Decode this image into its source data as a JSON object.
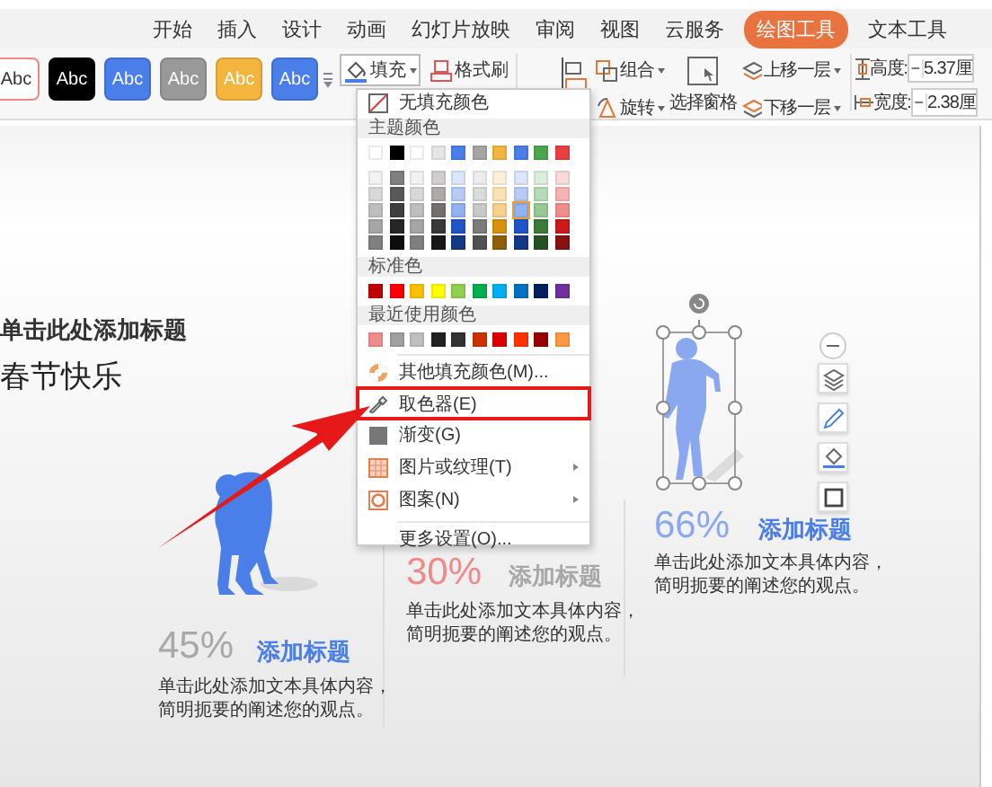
{
  "ribbon_tabs": [
    {
      "label": "开始",
      "selected": false
    },
    {
      "label": "插入",
      "selected": false
    },
    {
      "label": "设计",
      "selected": false
    },
    {
      "label": "动画",
      "selected": false
    },
    {
      "label": "幻灯片放映",
      "selected": false
    },
    {
      "label": "审阅",
      "selected": false
    },
    {
      "label": "视图",
      "selected": false
    },
    {
      "label": "云服务",
      "selected": false
    },
    {
      "label": "绘图工具",
      "selected": true
    },
    {
      "label": "文本工具",
      "selected": false
    }
  ],
  "ribbon": {
    "style_presets": [
      {
        "label": "Abc",
        "color": "#ffffff"
      },
      {
        "label": "Abc",
        "color": "#000000"
      },
      {
        "label": "Abc",
        "color": "#4a7ee8"
      },
      {
        "label": "Abc",
        "color": "#999999"
      },
      {
        "label": "Abc",
        "color": "#f4b53f"
      },
      {
        "label": "Abc",
        "color": "#4a7ee8"
      }
    ],
    "fill": "填充",
    "format_painter": "格式刷",
    "group": "组合",
    "rotate": "旋转",
    "selection_pane": "选择窗格",
    "bring_forward": "上移一层",
    "send_backward": "下移一层",
    "height": {
      "label": "高度:",
      "decrement": "−",
      "value": "5.37厘"
    },
    "width": {
      "label": "宽度:",
      "decrement": "−",
      "value": "2.38厘"
    }
  },
  "fill_menu": {
    "no_fill": "无填充颜色",
    "theme_heading": "主题颜色",
    "theme_colors": [
      {
        "color": "#ffffff"
      },
      {
        "color": "#000000"
      },
      {
        "color": "#ffffff"
      },
      {
        "color": "#e7e6e6"
      },
      {
        "color": "#4a7ee8"
      },
      {
        "color": "#a5a5a5"
      },
      {
        "color": "#f4b53f"
      },
      {
        "color": "#4a7ee8"
      },
      {
        "color": "#4ca64c"
      },
      {
        "color": "#e84040"
      }
    ],
    "shade_rows": [
      [
        {
          "color": "#f2f2f2",
          "selected": false
        },
        {
          "color": "#7f7f7f",
          "selected": false
        },
        {
          "color": "#f2f2f2",
          "selected": false
        },
        {
          "color": "#d0cece",
          "selected": false
        },
        {
          "color": "#dbe5fb",
          "selected": false
        },
        {
          "color": "#ededed",
          "selected": false
        },
        {
          "color": "#fdf0d9",
          "selected": false
        },
        {
          "color": "#dbe5fb",
          "selected": false
        },
        {
          "color": "#dbeddb",
          "selected": false
        },
        {
          "color": "#fad9d9",
          "selected": false
        }
      ],
      [
        {
          "color": "#d9d9d9",
          "selected": false
        },
        {
          "color": "#595959",
          "selected": false
        },
        {
          "color": "#d9d9d9",
          "selected": false
        },
        {
          "color": "#aeabab",
          "selected": false
        },
        {
          "color": "#b7cbf6",
          "selected": false
        },
        {
          "color": "#dbdbdb",
          "selected": false
        },
        {
          "color": "#fbe1b2",
          "selected": false
        },
        {
          "color": "#b7cbf6",
          "selected": false
        },
        {
          "color": "#b7dbb7",
          "selected": false
        },
        {
          "color": "#f6b3b3",
          "selected": false
        }
      ],
      [
        {
          "color": "#bfbfbf",
          "selected": false
        },
        {
          "color": "#3f3f3f",
          "selected": false
        },
        {
          "color": "#bfbfbf",
          "selected": false
        },
        {
          "color": "#757070",
          "selected": false
        },
        {
          "color": "#92b2f1",
          "selected": false
        },
        {
          "color": "#c9c9c9",
          "selected": false
        },
        {
          "color": "#f8d28c",
          "selected": false
        },
        {
          "color": "#92b2f1",
          "selected": true
        },
        {
          "color": "#94ca94",
          "selected": false
        },
        {
          "color": "#f18c8c",
          "selected": false
        }
      ],
      [
        {
          "color": "#a6a6a6",
          "selected": false
        },
        {
          "color": "#262626",
          "selected": false
        },
        {
          "color": "#a6a6a6",
          "selected": false
        },
        {
          "color": "#3a3838",
          "selected": false
        },
        {
          "color": "#1f55c8",
          "selected": false
        },
        {
          "color": "#7c7c7c",
          "selected": false
        },
        {
          "color": "#d8920e",
          "selected": false
        },
        {
          "color": "#1f55c8",
          "selected": false
        },
        {
          "color": "#387c38",
          "selected": false
        },
        {
          "color": "#cc1a1a",
          "selected": false
        }
      ],
      [
        {
          "color": "#808080",
          "selected": false
        },
        {
          "color": "#0d0d0d",
          "selected": false
        },
        {
          "color": "#808080",
          "selected": false
        },
        {
          "color": "#171616",
          "selected": false
        },
        {
          "color": "#143885",
          "selected": false
        },
        {
          "color": "#525252",
          "selected": false
        },
        {
          "color": "#905e09",
          "selected": false
        },
        {
          "color": "#143885",
          "selected": false
        },
        {
          "color": "#255225",
          "selected": false
        },
        {
          "color": "#881111",
          "selected": false
        }
      ]
    ],
    "standard_heading": "标准色",
    "standard_colors": [
      {
        "color": "#c00000"
      },
      {
        "color": "#ff0000"
      },
      {
        "color": "#ffc000"
      },
      {
        "color": "#ffff00"
      },
      {
        "color": "#92d050"
      },
      {
        "color": "#00b050"
      },
      {
        "color": "#00b0f0"
      },
      {
        "color": "#0070c0"
      },
      {
        "color": "#002060"
      },
      {
        "color": "#7030a0"
      }
    ],
    "recent_heading": "最近使用颜色",
    "recent_colors": [
      {
        "color": "#f08c8c"
      },
      {
        "color": "#a0a0a0"
      },
      {
        "color": "#c0c0c0"
      },
      {
        "color": "#222222"
      },
      {
        "color": "#333333"
      },
      {
        "color": "#cc3300"
      },
      {
        "color": "#dd0000"
      },
      {
        "color": "#ff3300"
      },
      {
        "color": "#990000"
      },
      {
        "color": "#ff9944"
      }
    ],
    "items": [
      {
        "kind": "more_colors",
        "label": "其他填充颜色(M)...",
        "submenu": false,
        "highlighted": false
      },
      {
        "kind": "eyedropper",
        "label": "取色器(E)",
        "submenu": false,
        "highlighted": true
      },
      {
        "kind": "gradient",
        "label": "渐变(G)",
        "submenu": false,
        "highlighted": false
      },
      {
        "kind": "texture",
        "label": "图片或纹理(T)",
        "submenu": true,
        "highlighted": false
      },
      {
        "kind": "pattern",
        "label": "图案(N)",
        "submenu": true,
        "highlighted": false
      },
      {
        "kind": "more_settings",
        "label": "更多设置(O)...",
        "submenu": false,
        "highlighted": false
      }
    ]
  },
  "slide": {
    "title": "单击此处添加标题",
    "subtitle": "春节快乐",
    "columns": [
      {
        "kind": "crouching",
        "selected": false,
        "percent": {
          "text": "45%",
          "color": "#a8a8a8"
        },
        "heading": {
          "text": "添加标题",
          "color": "#4a7ee8"
        },
        "body": "单击此处添加文本具体内容，简明扼要的阐述您的观点。"
      },
      {
        "kind": "plain",
        "selected": false,
        "percent": {
          "text": "30%",
          "color": "#f08a8a"
        },
        "heading": {
          "text": "添加标题",
          "color": "#a8a8a8"
        },
        "body": "单击此处添加文本具体内容，简明扼要的阐述您的观点。"
      },
      {
        "kind": "running",
        "selected": true,
        "percent": {
          "text": "66%",
          "color": "#8aa8f0"
        },
        "heading": {
          "text": "添加标题",
          "color": "#4a7ee8"
        },
        "body": "单击此处添加文本具体内容，简明扼要的阐述您的观点。"
      }
    ]
  }
}
